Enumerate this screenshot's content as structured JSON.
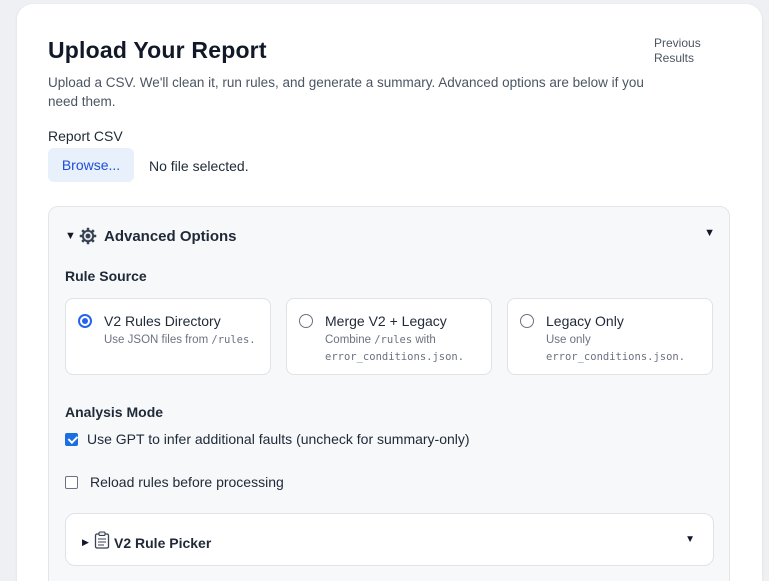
{
  "header": {
    "title": "Upload Your Report",
    "previous_results": "Previous Results",
    "subtitle": "Upload a CSV. We'll clean it, run rules, and generate a summary. Advanced options are below if you need them."
  },
  "upload": {
    "label": "Report CSV",
    "browse_label": "Browse...",
    "file_status": "No file selected."
  },
  "advanced": {
    "title": "Advanced Options",
    "rule_source_label": "Rule Source",
    "options": [
      {
        "title": "V2 Rules Directory",
        "desc_text": "Use JSON files from",
        "desc_code": "/rules.",
        "selected": true
      },
      {
        "title": "Merge V2 + Legacy",
        "desc_text": "Combine",
        "desc_code": "/rules",
        "desc_text2": "with",
        "desc_code2": "error_conditions.json.",
        "selected": false
      },
      {
        "title": "Legacy Only",
        "desc_text": "Use only",
        "desc_code": "error_conditions.json.",
        "selected": false
      }
    ],
    "analysis_mode_label": "Analysis Mode",
    "gpt_label": "Use GPT to infer additional faults (uncheck for summary-only)",
    "gpt_checked": true,
    "reload_label": "Reload rules before processing",
    "reload_checked": false,
    "picker_title": "V2 Rule Picker"
  },
  "icons": {
    "gear": "gear-icon",
    "clipboard": "clipboard-icon",
    "expand_open": "triangle-down-icon",
    "expand_closed": "triangle-right-icon"
  },
  "colors": {
    "accent": "#2563eb",
    "checkbox": "#1d6fe0",
    "button_bg": "#e8f0fb",
    "panel_bg": "#f6f8fa"
  }
}
